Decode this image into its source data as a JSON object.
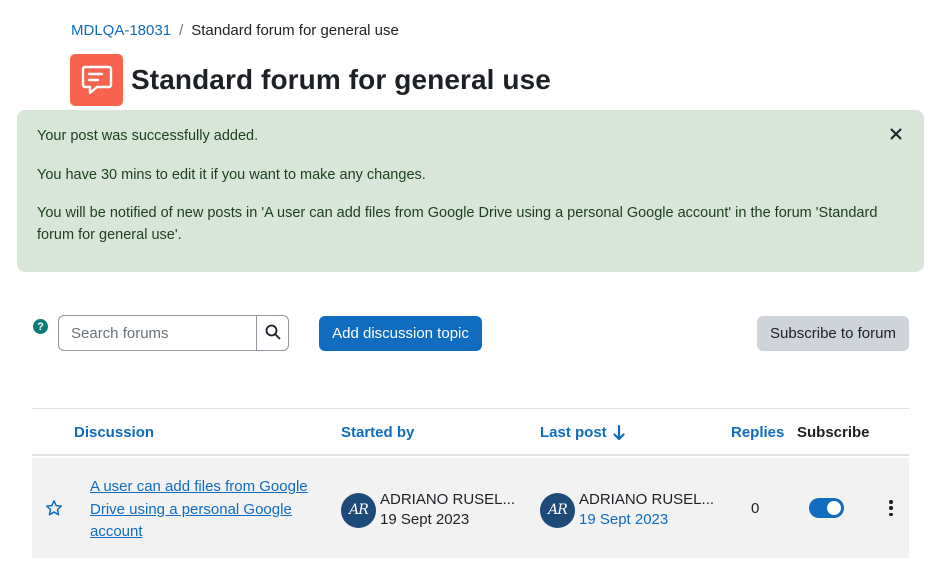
{
  "breadcrumb": {
    "course": "MDLQA-18031",
    "separator": "/",
    "current": "Standard forum for general use"
  },
  "page": {
    "title": "Standard forum for general use",
    "icon": "forum-icon",
    "icon_color": "#f7634d"
  },
  "alert": {
    "line1": "Your post was successfully added.",
    "line2": "You have 30 mins to edit it if you want to make any changes.",
    "line3": "You will be notified of new posts in 'A user can add files from Google Drive using a personal Google account' in the forum 'Standard forum for general use'.",
    "background": "#d7e6d8"
  },
  "toolbar": {
    "help_glyph": "?",
    "search_placeholder": "Search forums",
    "add_label": "Add discussion topic",
    "subscribe_label": "Subscribe to forum"
  },
  "table": {
    "headers": {
      "discussion": "Discussion",
      "started_by": "Started by",
      "last_post": "Last post",
      "replies": "Replies",
      "subscribe": "Subscribe"
    },
    "rows": [
      {
        "title": "A user can add files from Google Drive using a personal Google account",
        "started_by": {
          "name": "ADRIANO RUSEL...",
          "date": "19 Sept 2023",
          "initials": "AR"
        },
        "last_post": {
          "name": "ADRIANO RUSEL...",
          "date": "19 Sept 2023",
          "initials": "AR"
        },
        "replies": "0",
        "subscribed": true
      }
    ]
  },
  "colors": {
    "primary": "#0f6cbf",
    "secondary": "#ced4da",
    "row_bg": "#f2f2f2"
  }
}
